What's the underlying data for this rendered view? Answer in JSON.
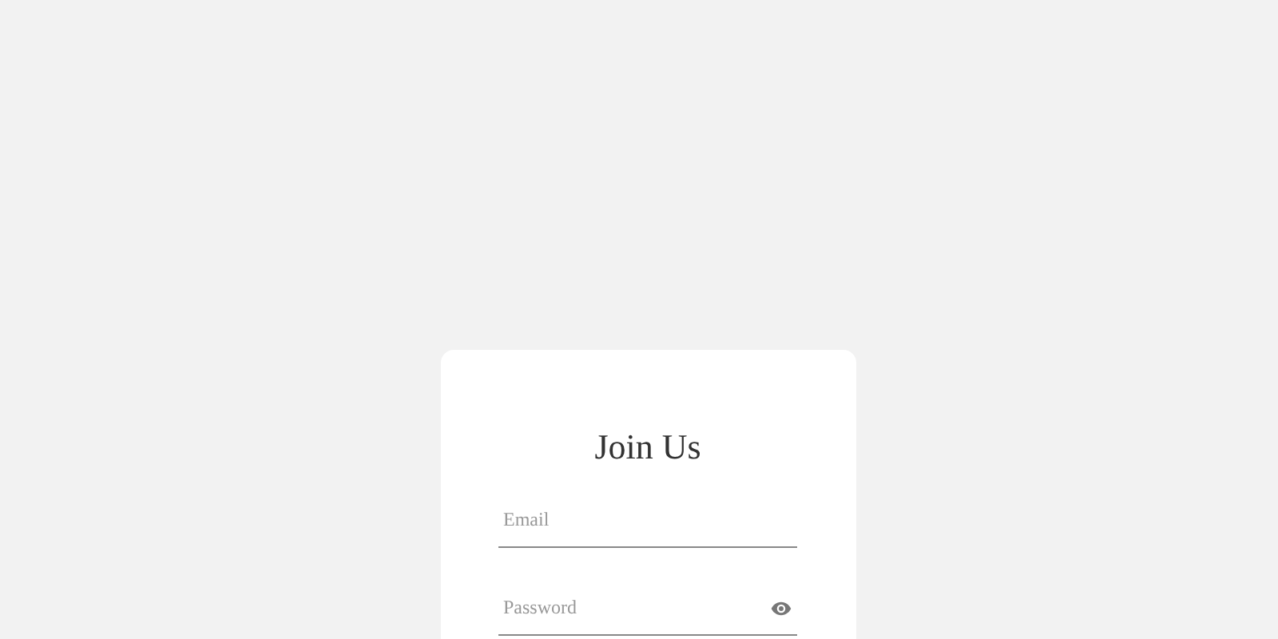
{
  "title": "Join Us",
  "fields": [
    {
      "kind": "text",
      "placeholder": "Email"
    },
    {
      "kind": "password",
      "placeholder": "Password"
    }
  ]
}
